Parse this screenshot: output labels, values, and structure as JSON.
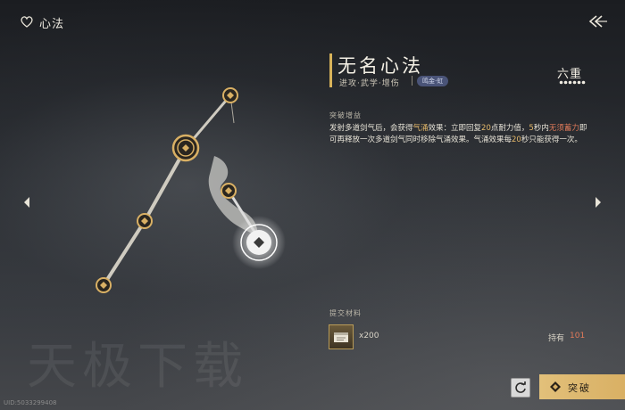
{
  "header": {
    "title": "心法",
    "icon": "heart-outline-icon",
    "back_icon": "double-back-arrow-icon"
  },
  "skill": {
    "name": "无名心法",
    "tags": "进攻·武学·增伤",
    "badge": "鸣金·虹",
    "rank": "六重",
    "rank_dots_total": 6,
    "rank_dots_filled": 6
  },
  "breakthrough": {
    "gain_label": "突破增益",
    "desc_1": "发射多道剑气后，会获得",
    "desc_hl_1": "气涌",
    "desc_2": "效果：立即回复",
    "desc_hl_2": "20",
    "desc_3": "点耐力值，",
    "desc_hl_3": "5",
    "desc_4": "秒内",
    "desc_hl_4": "无须蓄力",
    "desc_5": "即可再释放一次多道剑气同时移除气涌效果。气涌效果每",
    "desc_hl_5": "20",
    "desc_6": "秒只能获得一次。"
  },
  "materials": {
    "label": "提交材料",
    "item_icon": "scroll-book-icon",
    "qty": "x200",
    "owned_label": "持有",
    "owned_value": "101"
  },
  "buttons": {
    "break_label": "突破",
    "reset_icon": "refresh-icon",
    "break_icon": "diamond-icon"
  },
  "watermark": "天极下载",
  "uid": "UID:5033299408",
  "colors": {
    "accent": "#d9b064",
    "highlight_red": "#e07a5a",
    "highlight_gold": "#e5b96a"
  }
}
